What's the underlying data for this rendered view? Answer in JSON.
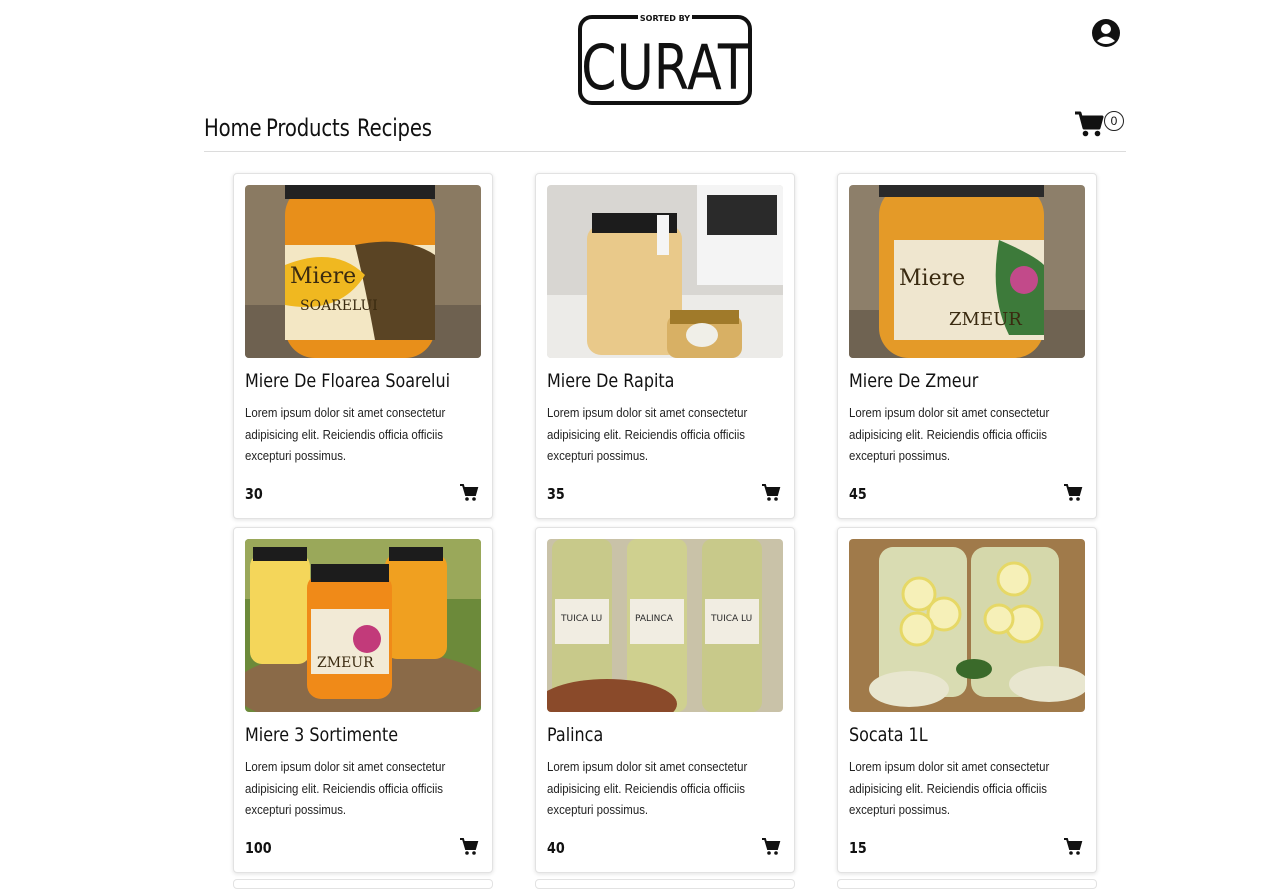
{
  "brand": {
    "tagline": "SORTED BY",
    "name": "CURAT"
  },
  "icons": {
    "account": "account-circle-icon",
    "cart": "shopping-cart-icon",
    "add_to_cart": "add-to-cart-icon"
  },
  "nav": {
    "items": [
      "Home",
      "Products",
      "Recipes"
    ]
  },
  "cart": {
    "count": "0"
  },
  "products": [
    {
      "name": "Miere De Floarea Soarelui",
      "description": "Lorem ipsum dolor sit amet consectetur adipisicing elit. Reiciendis officia officiis excepturi possimus.",
      "price": "30"
    },
    {
      "name": "Miere De Rapita",
      "description": "Lorem ipsum dolor sit amet consectetur adipisicing elit. Reiciendis officia officiis excepturi possimus.",
      "price": "35"
    },
    {
      "name": "Miere De Zmeur",
      "description": "Lorem ipsum dolor sit amet consectetur adipisicing elit. Reiciendis officia officiis excepturi possimus.",
      "price": "45"
    },
    {
      "name": "Miere 3 Sortimente",
      "description": "Lorem ipsum dolor sit amet consectetur adipisicing elit. Reiciendis officia officiis excepturi possimus.",
      "price": "100"
    },
    {
      "name": "Palinca",
      "description": "Lorem ipsum dolor sit amet consectetur adipisicing elit. Reiciendis officia officiis excepturi possimus.",
      "price": "40"
    },
    {
      "name": "Socata 1L",
      "description": "Lorem ipsum dolor sit amet consectetur adipisicing elit. Reiciendis officia officiis excepturi possimus.",
      "price": "15"
    }
  ]
}
